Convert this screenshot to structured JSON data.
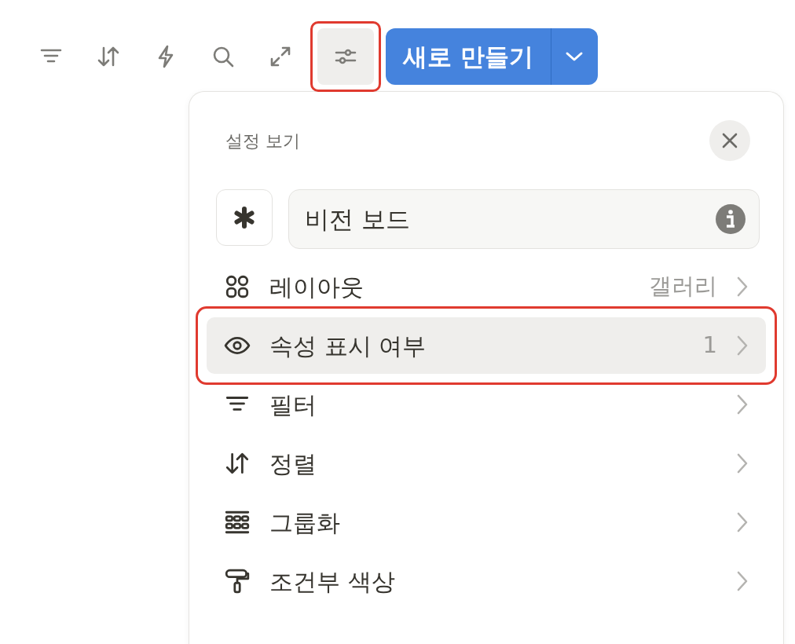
{
  "toolbar": {
    "icons": [
      {
        "kind": "filter",
        "selected": false,
        "highlighted": false
      },
      {
        "kind": "sort",
        "selected": false,
        "highlighted": false
      },
      {
        "kind": "automation",
        "selected": false,
        "highlighted": false
      },
      {
        "kind": "search",
        "selected": false,
        "highlighted": false
      },
      {
        "kind": "expand",
        "selected": false,
        "highlighted": false
      },
      {
        "kind": "settings",
        "selected": true,
        "highlighted": true
      }
    ],
    "new_button": {
      "label": "새로 만들기"
    }
  },
  "panel": {
    "title": "설정 보기",
    "name_field": {
      "value": "비전 보드"
    },
    "items": [
      {
        "kind": "layout",
        "label": "레이아웃",
        "value": "갤러리",
        "selected": false,
        "highlighted": false
      },
      {
        "kind": "visibility",
        "label": "속성 표시 여부",
        "value": "1",
        "selected": true,
        "highlighted": true
      },
      {
        "kind": "filter",
        "label": "필터",
        "selected": false,
        "highlighted": false
      },
      {
        "kind": "sort",
        "label": "정렬",
        "selected": false,
        "highlighted": false
      },
      {
        "kind": "group",
        "label": "그룹화",
        "selected": false,
        "highlighted": false
      },
      {
        "kind": "color",
        "label": "조건부 색상",
        "selected": false,
        "highlighted": false
      }
    ]
  }
}
